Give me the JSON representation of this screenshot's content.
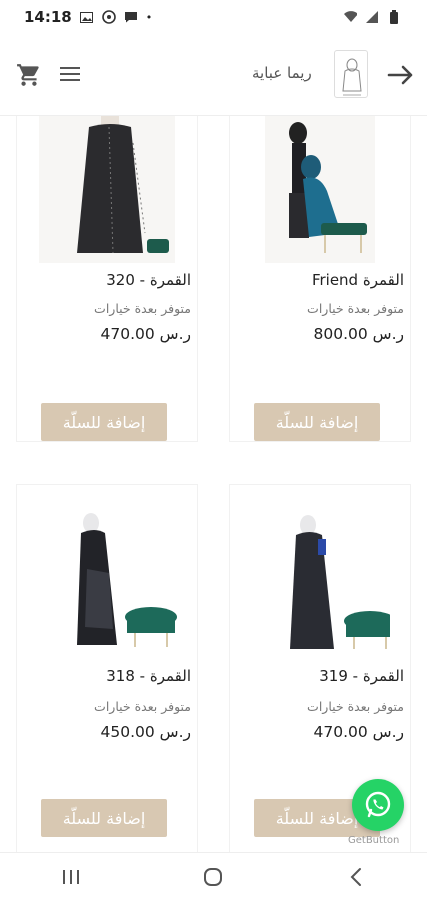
{
  "status_bar": {
    "time": "14:18",
    "bullet": "•",
    "icons_left": [
      "image-icon",
      "whatsapp-status-icon",
      "message-icon"
    ],
    "icons_right": [
      "wifi-icon",
      "signal-icon",
      "battery-icon"
    ]
  },
  "header": {
    "brand_name": "ريما عباية",
    "icons": [
      "cart-icon",
      "menu-icon",
      "logo",
      "back-arrow-icon"
    ]
  },
  "products": [
    {
      "title": "القمرة Friend",
      "availability": "متوفر بعدة خيارات",
      "price": "ر.س 800.00",
      "button": "إضافة للسلّة"
    },
    {
      "title": "القمرة - 320",
      "availability": "متوفر بعدة خيارات",
      "price": "ر.س 470.00",
      "button": "إضافة للسلّة"
    },
    {
      "title": "القمرة - 319",
      "availability": "متوفر بعدة خيارات",
      "price": "ر.س 470.00",
      "button": "إضافة للسلّة"
    },
    {
      "title": "القمرة - 318",
      "availability": "متوفر بعدة خيارات",
      "price": "ر.س 450.00",
      "button": "إضافة للسلّة"
    }
  ],
  "whatsapp": {
    "label": "GetButton"
  },
  "colors": {
    "add_button": "#d8c8b2",
    "whatsapp": "#25d366"
  }
}
